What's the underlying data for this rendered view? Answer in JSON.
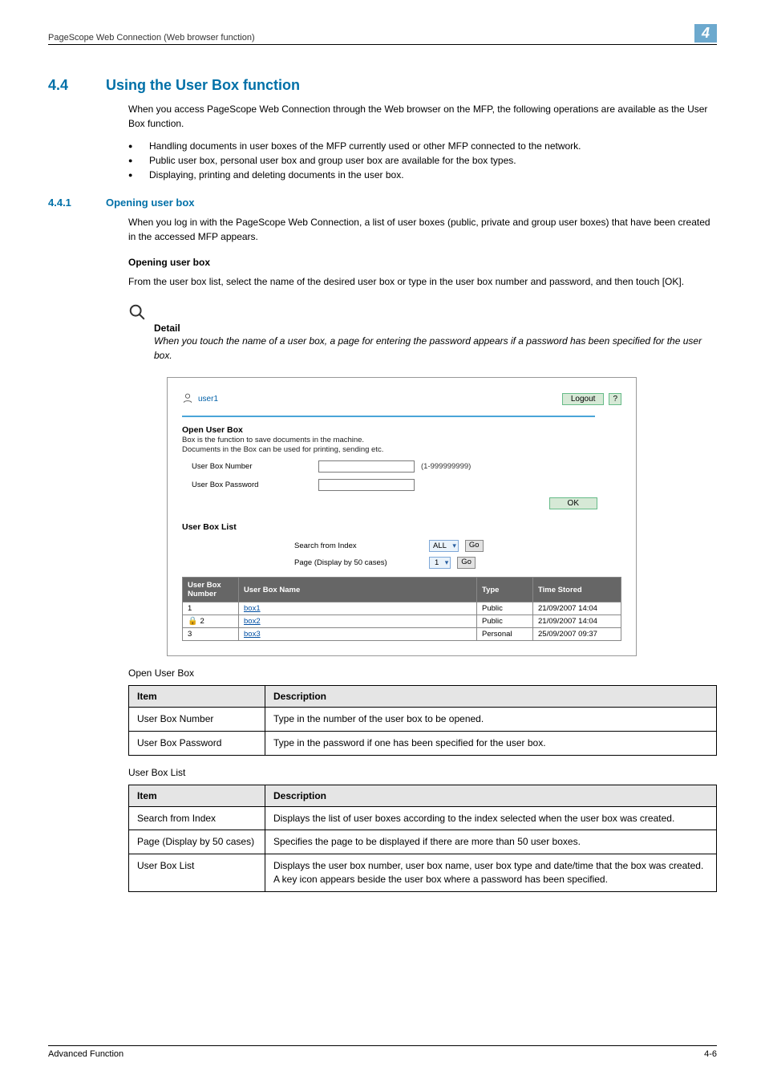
{
  "header": {
    "breadcrumb": "PageScope Web Connection (Web browser function)",
    "section_number": "4"
  },
  "section4_4": {
    "number": "4.4",
    "title": "Using the User Box function",
    "intro": "When you access PageScope Web Connection through the Web browser on the MFP, the following operations are available as the User Box function.",
    "bullets": [
      "Handling documents in user boxes of the MFP currently used or other MFP connected to the network.",
      "Public user box, personal user box and group user box are available for the box types.",
      "Displaying, printing and deleting documents in the user box."
    ]
  },
  "section4_4_1": {
    "number": "4.4.1",
    "title": "Opening user box",
    "p1": "When you log in with the PageScope Web Connection, a list of user boxes (public, private and group user boxes) that have been created in the accessed MFP appears.",
    "sub_heading": "Opening user box",
    "p2": "From the user box list, select the name of the desired user box or type in the user box number and password, and then touch [OK].",
    "detail_label": "Detail",
    "detail_text": "When you touch the name of a user box, a page for entering the password appears if a password has been specified for the user box."
  },
  "screenshot": {
    "user": "user1",
    "logout": "Logout",
    "help": "?",
    "open_heading": "Open User Box",
    "open_desc1": "Box is the function to save documents in the machine.",
    "open_desc2": "Documents in the Box can be used for printing, sending etc.",
    "row_number_label": "User Box Number",
    "row_number_range": "(1-999999999)",
    "row_password_label": "User Box Password",
    "ok": "OK",
    "list_heading": "User Box List",
    "search_label": "Search from Index",
    "search_value": "ALL",
    "go": "Go",
    "page_label": "Page (Display by 50 cases)",
    "page_value": "1",
    "table": {
      "headers": [
        "User Box Number",
        "User Box Name",
        "Type",
        "Time Stored"
      ],
      "rows": [
        {
          "num": "1",
          "name": "box1",
          "type": "Public",
          "time": "21/09/2007 14:04",
          "lock": false
        },
        {
          "num": "2",
          "name": "box2",
          "type": "Public",
          "time": "21/09/2007 14:04",
          "lock": true
        },
        {
          "num": "3",
          "name": "box3",
          "type": "Personal",
          "time": "25/09/2007 09:37",
          "lock": false
        }
      ]
    }
  },
  "open_caption": "Open User Box",
  "open_table": {
    "headers": [
      "Item",
      "Description"
    ],
    "rows": [
      [
        "User Box Number",
        "Type in the number of the user box to be opened."
      ],
      [
        "User Box Password",
        "Type in the password if one has been specified for the user box."
      ]
    ]
  },
  "list_caption": "User Box List",
  "list_table": {
    "headers": [
      "Item",
      "Description"
    ],
    "rows": [
      [
        "Search from Index",
        "Displays the list of user boxes according to the index selected when the user box was created."
      ],
      [
        "Page (Display by 50 cases)",
        "Specifies the page to be displayed if there are more than 50 user boxes."
      ],
      [
        "User Box List",
        "Displays the user box number, user box name, user box type and date/time that the box was created. A key icon appears beside the user box where a password has been specified."
      ]
    ]
  },
  "footer": {
    "left": "Advanced Function",
    "right": "4-6"
  }
}
